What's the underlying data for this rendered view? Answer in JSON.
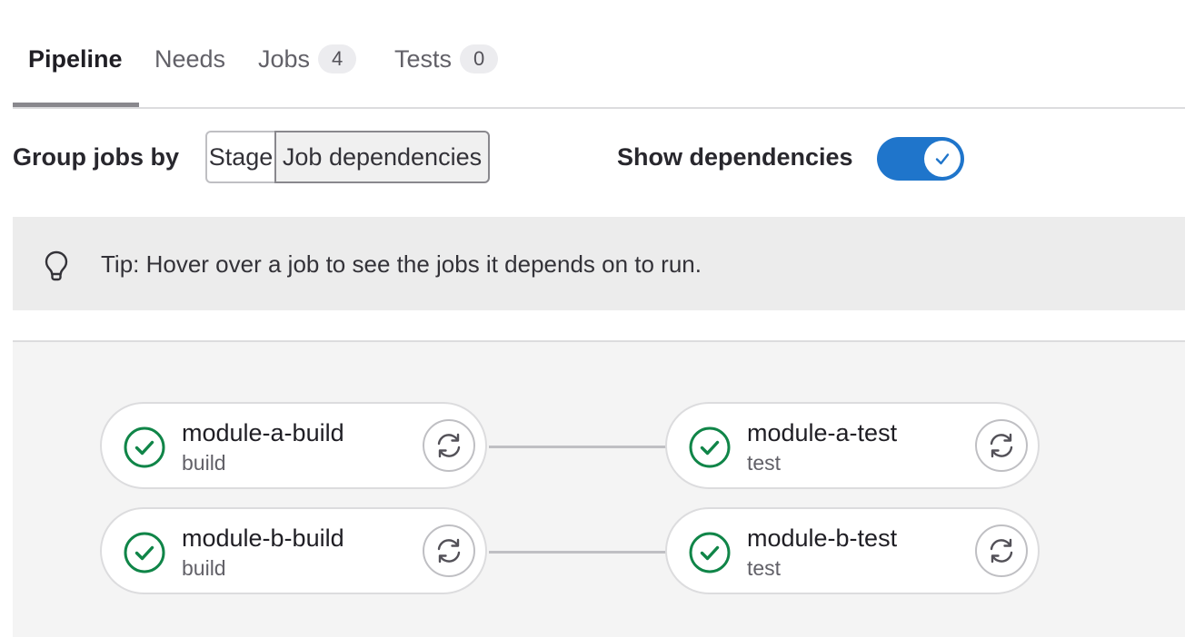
{
  "tabs": [
    {
      "label": "Pipeline",
      "count": null
    },
    {
      "label": "Needs",
      "count": null
    },
    {
      "label": "Jobs",
      "count": "4"
    },
    {
      "label": "Tests",
      "count": "0"
    }
  ],
  "controls": {
    "group_label": "Group jobs by",
    "options": [
      "Stage",
      "Job dependencies"
    ],
    "selected": "Job dependencies",
    "show_dependencies_label": "Show dependencies",
    "show_dependencies_on": true
  },
  "tip": {
    "icon": "bulb-icon",
    "text": "Tip: Hover over a job to see the jobs it depends on to run."
  },
  "jobs": [
    {
      "name": "module-a-build",
      "stage": "build",
      "status": "success"
    },
    {
      "name": "module-a-test",
      "stage": "test",
      "status": "success"
    },
    {
      "name": "module-b-build",
      "stage": "build",
      "status": "success"
    },
    {
      "name": "module-b-test",
      "stage": "test",
      "status": "success"
    }
  ],
  "colors": {
    "success": "#108548",
    "toggle": "#1f75cb"
  }
}
